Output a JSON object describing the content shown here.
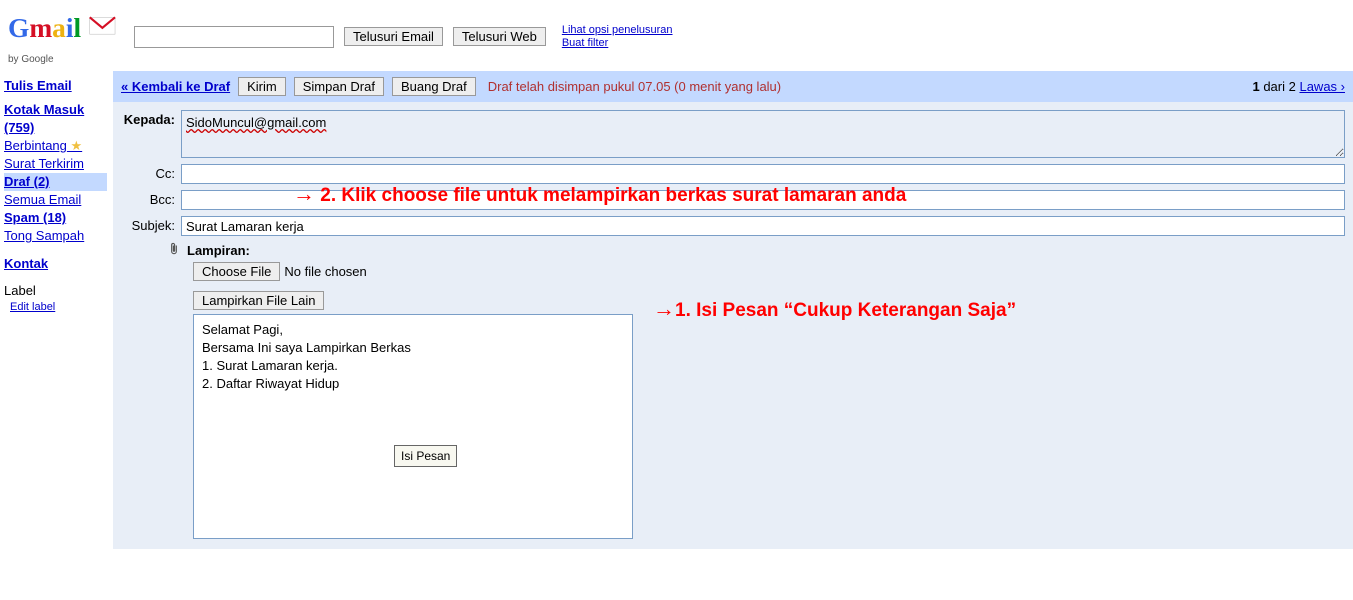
{
  "header": {
    "search_btn_email": "Telusuri Email",
    "search_btn_web": "Telusuri Web",
    "link_search_opts": "Lihat opsi penelusuran",
    "link_create_filter": "Buat filter",
    "by_google": "by Google"
  },
  "sidebar": {
    "compose": "Tulis Email",
    "inbox": "Kotak Masuk (759)",
    "starred": "Berbintang",
    "sent": "Surat Terkirim",
    "drafts": "Draf (2)",
    "all_mail": "Semua Email",
    "spam": "Spam (18)",
    "trash": "Tong Sampah",
    "contacts": "Kontak",
    "labels_header": "Label",
    "edit_label": "Edit label"
  },
  "actionbar": {
    "back": "« Kembali ke Draf",
    "send": "Kirim",
    "save_draft": "Simpan Draf",
    "discard": "Buang Draf",
    "status": "Draf telah disimpan pukul 07.05 (0 menit yang lalu)",
    "count_left": "1",
    "count_mid": " dari 2 ",
    "older": "Lawas ›"
  },
  "compose": {
    "label_to": "Kepada:",
    "label_cc": "Cc:",
    "label_bcc": "Bcc:",
    "label_subject": "Subjek:",
    "label_attach": "Lampiran:",
    "to_value": "SidoMuncul@gmail.com",
    "subject_value": "Surat Lamaran kerja",
    "choose_file": "Choose File",
    "no_file": "No file chosen",
    "attach_more": "Lampirkan File Lain",
    "body_line1": "Selamat Pagi,",
    "body_line2": "",
    "body_line3": "Bersama Ini saya Lampirkan Berkas",
    "body_line4": "",
    "body_line5": "1. Surat Lamaran kerja.",
    "body_line6": "2. Daftar Riwayat Hidup",
    "tooltip": "Isi Pesan"
  },
  "annotations": {
    "a2": "2. Klik choose file untuk melampirkan berkas surat lamaran anda",
    "a1": "1. Isi Pesan “Cukup Keterangan Saja”"
  }
}
